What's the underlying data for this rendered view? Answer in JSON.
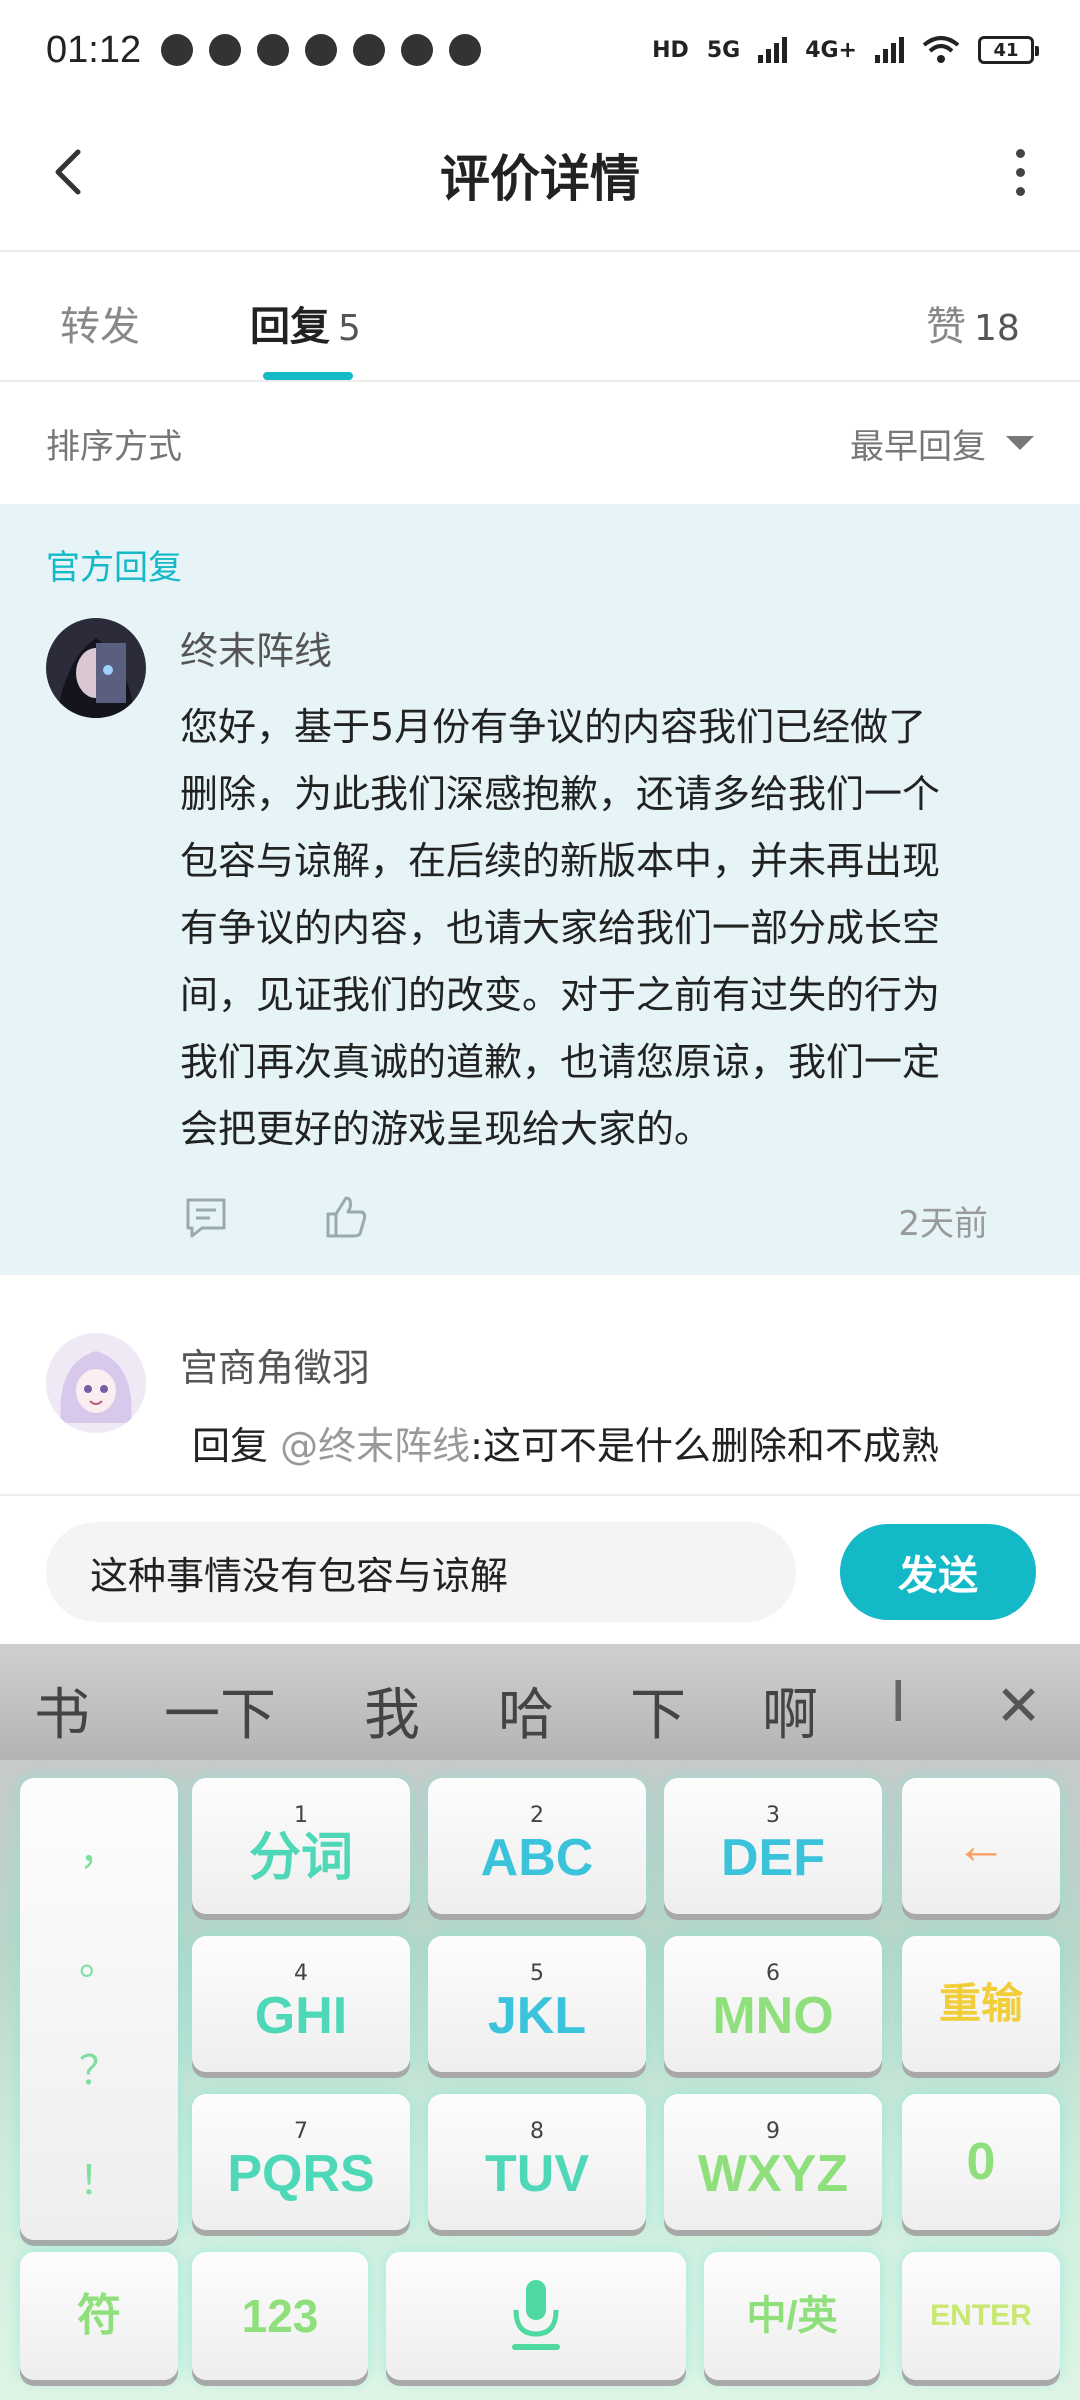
{
  "status_bar": {
    "time": "01:12",
    "network_labels": [
      "HD",
      "5G",
      "4G+"
    ],
    "battery": "41"
  },
  "header": {
    "title": "评价详情"
  },
  "tabs": [
    {
      "label": "转发",
      "count": ""
    },
    {
      "label": "回复",
      "count": "5"
    },
    {
      "label": "赞",
      "count": "18"
    }
  ],
  "sort": {
    "label": "排序方式",
    "value": "最早回复"
  },
  "official_reply": {
    "tag": "官方回复",
    "author": "终末阵线",
    "lines": [
      "您好，基于5月份有争议的内容我们已经做了",
      "删除，为此我们深感抱歉，还请多给我们一个",
      "包容与谅解，在后续的新版本中，并未再出现",
      "有争议的内容，也请大家给我们一部分成长空",
      "间，见证我们的改变。对于之前有过失的行为",
      "我们再次真诚的道歉，也请您原谅，我们一定",
      "会把更好的游戏呈现给大家的。"
    ],
    "time": "2天前"
  },
  "comment": {
    "author": "宫商角徵羽",
    "reply_prefix": "回复",
    "mention": "@终末阵线",
    "reply_text": ":这可不是什么删除和不成熟"
  },
  "input": {
    "value": "这种事情没有包容与谅解",
    "send_label": "发送"
  },
  "keyboard": {
    "candidates": [
      "书",
      "一下",
      "我",
      "哈",
      "下",
      "啊",
      "I"
    ],
    "punctuation": [
      "，",
      "。",
      "？",
      "！"
    ],
    "keys": [
      {
        "num": "1",
        "label": "分词"
      },
      {
        "num": "2",
        "label": "ABC"
      },
      {
        "num": "3",
        "label": "DEF"
      },
      {
        "num": "4",
        "label": "GHI"
      },
      {
        "num": "5",
        "label": "JKL"
      },
      {
        "num": "6",
        "label": "MNO"
      },
      {
        "num": "7",
        "label": "PQRS"
      },
      {
        "num": "8",
        "label": "TUV"
      },
      {
        "num": "9",
        "label": "WXYZ"
      }
    ],
    "backspace": "←",
    "reenter": "重输",
    "zero": "0",
    "symbols": "符",
    "numbers": "123",
    "lang": "中/英",
    "enter": "ENTER"
  },
  "colors": {
    "accent": "#14b9c8",
    "official_bg": "#e6f4f7"
  }
}
